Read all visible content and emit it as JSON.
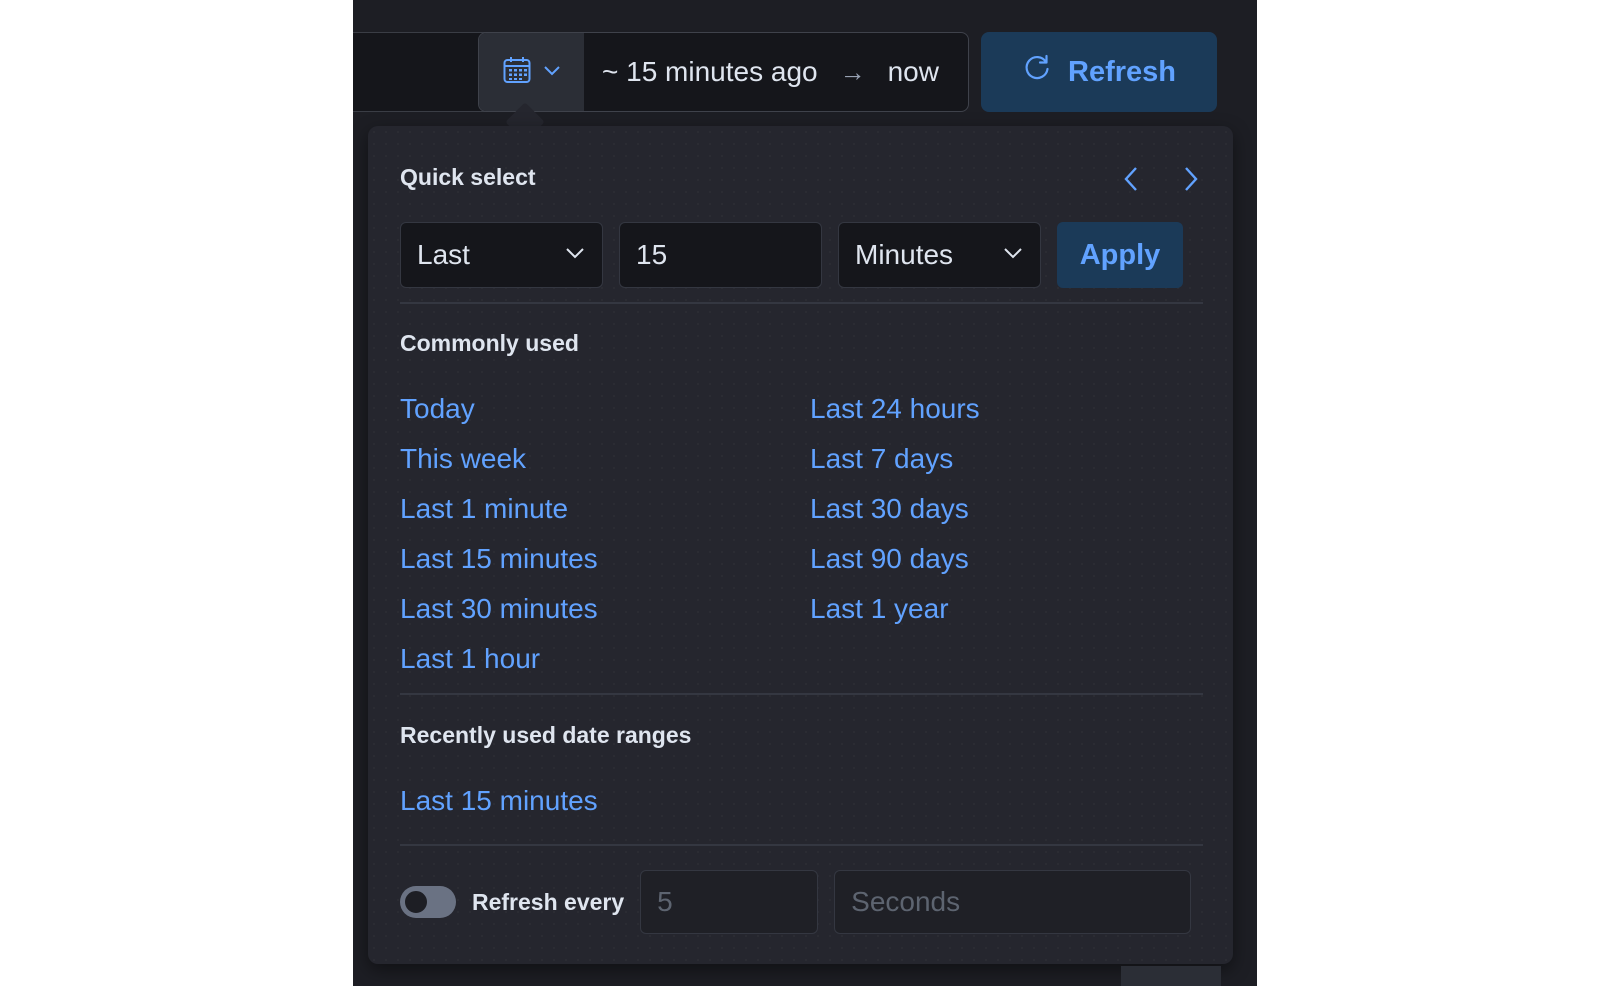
{
  "top_bar": {
    "range_start": "~ 15 minutes ago",
    "range_arrow": "→",
    "range_end": "now",
    "refresh_label": "Refresh"
  },
  "quick_select": {
    "title": "Quick select",
    "direction_value": "Last",
    "amount_value": "15",
    "unit_value": "Minutes",
    "apply_label": "Apply"
  },
  "commonly_used": {
    "title": "Commonly used",
    "items": [
      "Today",
      "This week",
      "Last 1 minute",
      "Last 15 minutes",
      "Last 30 minutes",
      "Last 1 hour",
      "Last 24 hours",
      "Last 7 days",
      "Last 30 days",
      "Last 90 days",
      "Last 1 year"
    ]
  },
  "recently_used": {
    "title": "Recently used date ranges",
    "items": [
      "Last 15 minutes"
    ]
  },
  "auto_refresh": {
    "label": "Refresh every",
    "interval_placeholder": "5",
    "unit_placeholder": "Seconds",
    "enabled": false
  },
  "colors": {
    "accent": "#61a2ff",
    "background": "#1d1e24",
    "popover": "#25262e",
    "button_fill": "#1b3a58"
  }
}
